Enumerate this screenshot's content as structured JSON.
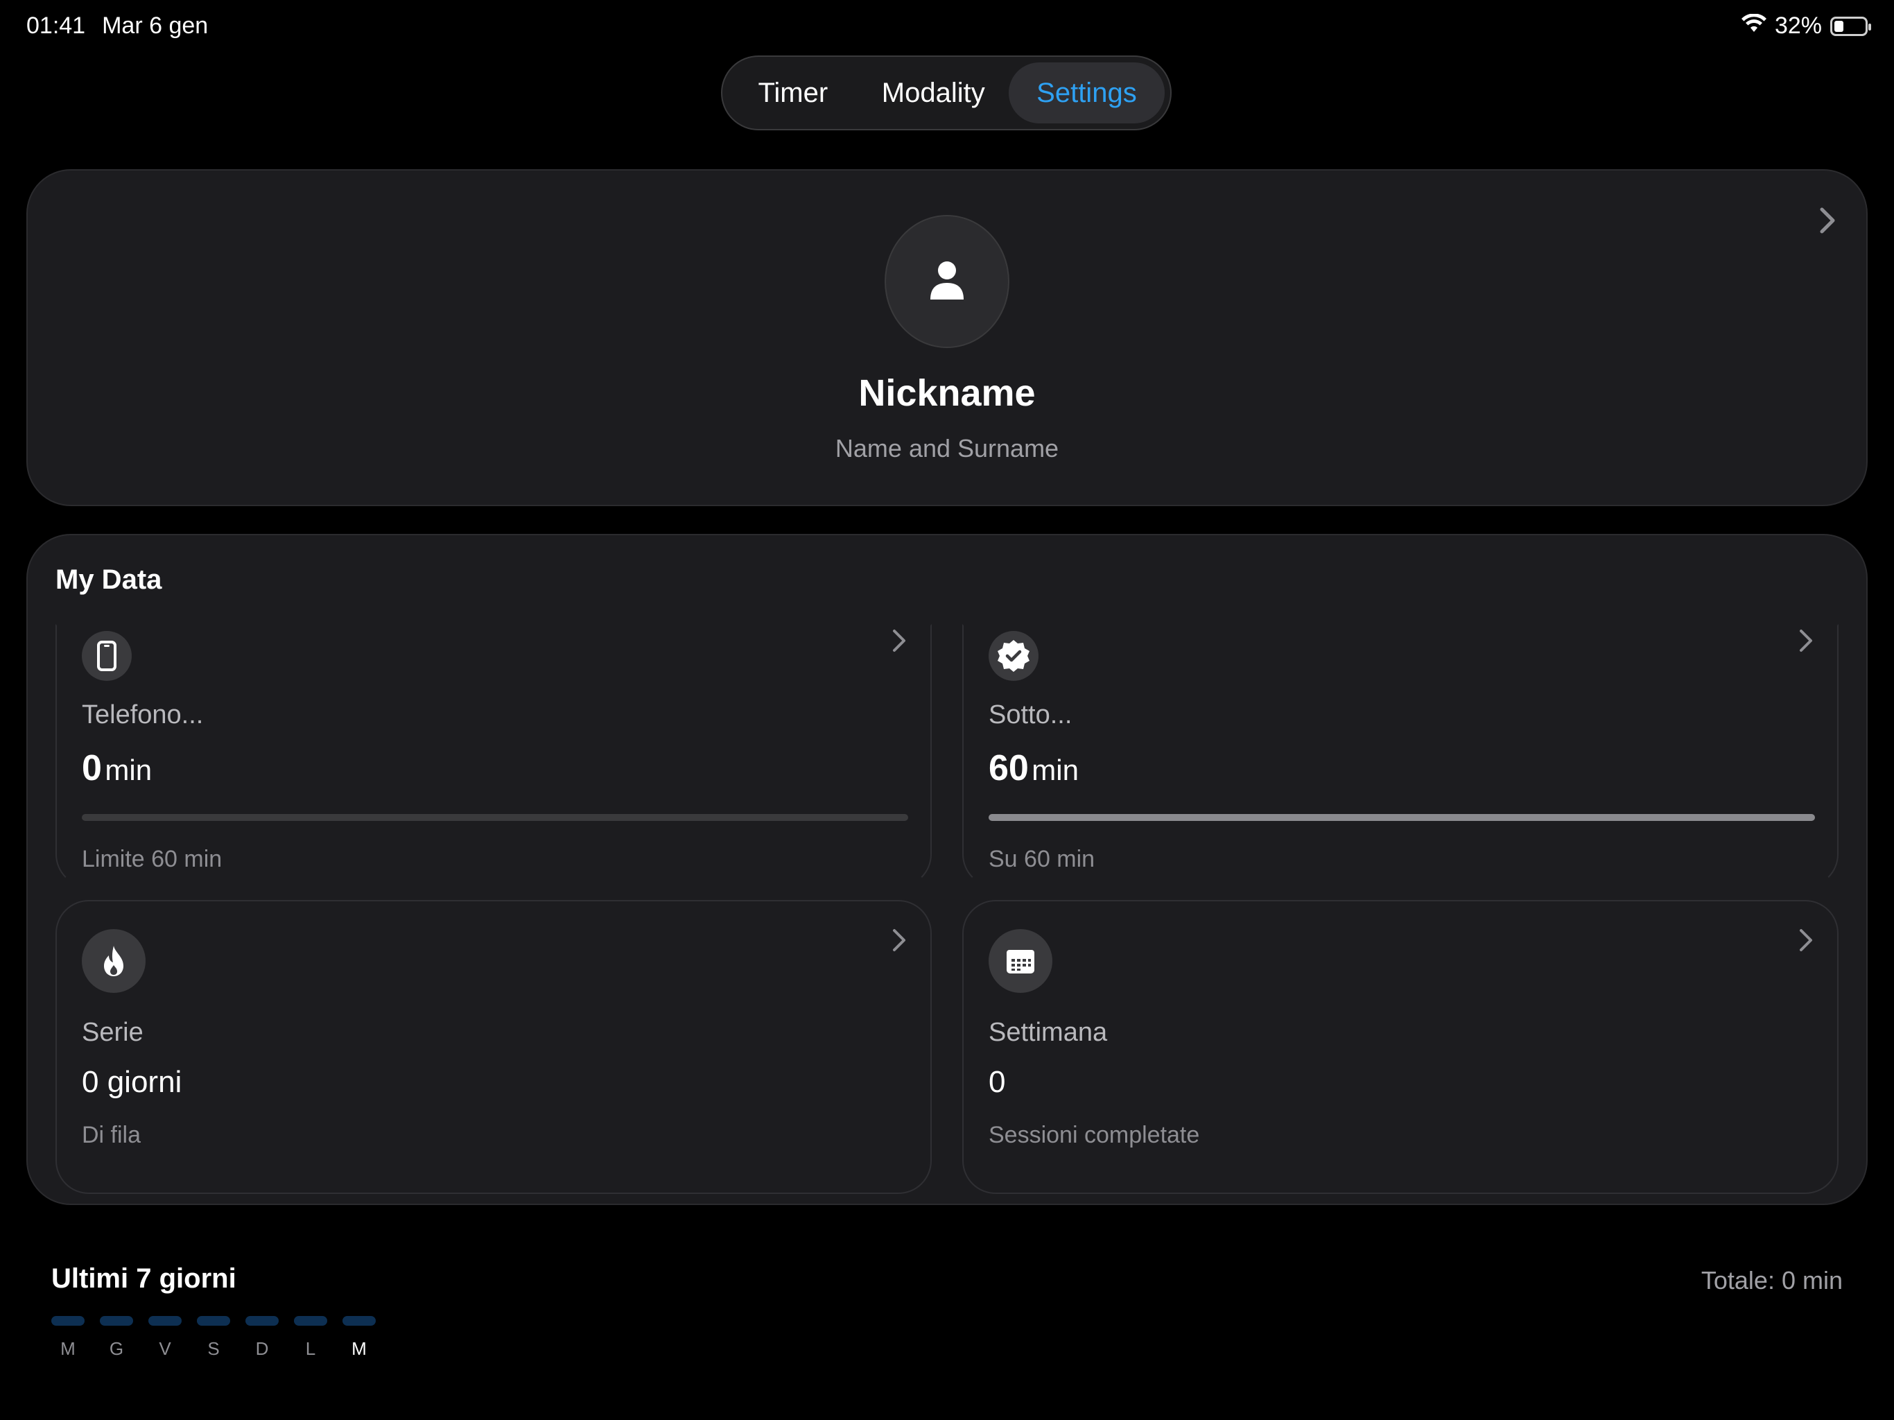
{
  "status_bar": {
    "time": "01:41",
    "date": "Mar 6 gen",
    "battery": "32%",
    "battery_level": 0.32,
    "wifi_icon": "wifi-icon",
    "battery_icon": "battery-icon"
  },
  "tabs": [
    {
      "label": "Timer",
      "selected": false
    },
    {
      "label": "Modality",
      "selected": false
    },
    {
      "label": "Settings",
      "selected": true
    }
  ],
  "accent_color": "#2ea1f3",
  "profile": {
    "nickname": "Nickname",
    "full_name": "Name and Surname",
    "avatar_icon": "person-icon"
  },
  "my_data": {
    "title": "My Data",
    "tiles": [
      {
        "icon": "phone-icon",
        "label": "Telefono...",
        "value": "0",
        "unit": "min",
        "progress": 0,
        "caption": "Limite 60 min"
      },
      {
        "icon": "verified-check-icon",
        "label": "Sotto...",
        "value": "60",
        "unit": "min",
        "progress": 1.0,
        "caption": "Su 60 min"
      },
      {
        "icon": "flame-icon",
        "label": "Serie",
        "value": "0 giorni",
        "caption": "Di fila"
      },
      {
        "icon": "calendar-icon",
        "label": "Settimana",
        "value": "0",
        "caption": "Sessioni completate"
      }
    ]
  },
  "last_7_days": {
    "title": "Ultimi 7 giorni",
    "total": "Totale: 0 min",
    "days": [
      "M",
      "G",
      "V",
      "S",
      "D",
      "L",
      "M"
    ],
    "minutes": [
      0,
      0,
      0,
      0,
      0,
      0,
      0
    ],
    "today_index": 6
  }
}
